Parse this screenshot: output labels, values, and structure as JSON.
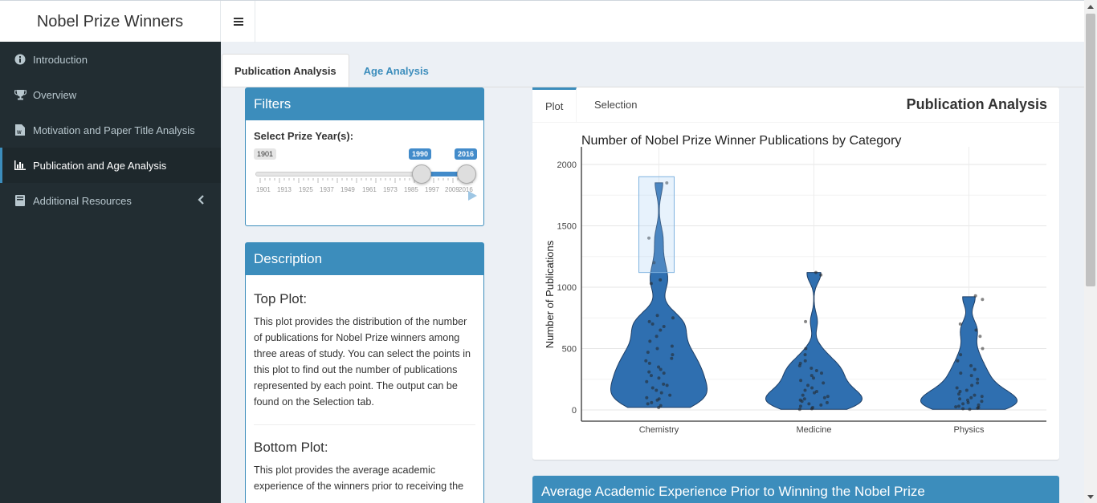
{
  "app": {
    "title": "Nobel Prize Winners"
  },
  "sidebar": {
    "items": [
      {
        "label": "Introduction",
        "icon": "info-circle-icon"
      },
      {
        "label": "Overview",
        "icon": "trophy-icon"
      },
      {
        "label": "Motivation and Paper Title Analysis",
        "icon": "word-file-icon"
      },
      {
        "label": "Publication and Age Analysis",
        "icon": "bar-chart-icon",
        "active": true
      },
      {
        "label": "Additional Resources",
        "icon": "book-icon"
      }
    ]
  },
  "tabs": {
    "publication": "Publication Analysis",
    "age": "Age Analysis"
  },
  "filters": {
    "title": "Filters",
    "label": "Select Prize Year(s):",
    "min": "1901",
    "from": "1990",
    "to": "2016",
    "ticks": [
      "1901",
      "1913",
      "1925",
      "1937",
      "1949",
      "1961",
      "1973",
      "1985",
      "1997",
      "2009",
      "2016"
    ]
  },
  "description": {
    "title": "Description",
    "top_heading": "Top Plot:",
    "top_text": "This plot provides the distribution of the number of publications for Nobel Prize winners among three areas of study. You can select the points in this plot to find out the number of publications represented by each point. The output can be found on the Selection tab.",
    "bottom_heading": "Bottom Plot:",
    "bottom_text": "This plot provides the average academic experience of the winners prior to receiving the"
  },
  "plot_panel": {
    "tab_plot": "Plot",
    "tab_selection": "Selection",
    "title": "Publication Analysis"
  },
  "bottom_box": {
    "title": "Average Academic Experience Prior to Winning the Nobel Prize"
  },
  "chart_data": {
    "type": "violin",
    "title": "Number of Nobel Prize Winner Publications by Category",
    "xlabel": "",
    "ylabel": "Number of Publications",
    "categories": [
      "Chemistry",
      "Medicine",
      "Physics"
    ],
    "ylim": [
      0,
      2000
    ],
    "yticks": [
      0,
      500,
      1000,
      1500,
      2000
    ],
    "color": "#2f6fb0",
    "selection_box": {
      "category": "Chemistry",
      "y_range": [
        1120,
        1900
      ]
    },
    "series": [
      {
        "name": "Chemistry",
        "points": [
          20,
          35,
          50,
          60,
          80,
          90,
          100,
          120,
          140,
          160,
          180,
          200,
          210,
          230,
          260,
          280,
          300,
          310,
          330,
          350,
          380,
          400,
          420,
          450,
          470,
          500,
          520,
          560,
          600,
          650,
          680,
          700,
          720,
          750,
          770,
          1030,
          1060,
          1200,
          1400,
          1850
        ]
      },
      {
        "name": "Medicine",
        "points": [
          5,
          10,
          20,
          30,
          40,
          50,
          60,
          70,
          80,
          90,
          100,
          110,
          120,
          140,
          150,
          160,
          180,
          200,
          220,
          240,
          260,
          280,
          300,
          320,
          340,
          360,
          380,
          400,
          450,
          500,
          720,
          1100,
          1120
        ]
      },
      {
        "name": "Physics",
        "points": [
          5,
          10,
          15,
          20,
          25,
          30,
          40,
          50,
          60,
          70,
          80,
          90,
          100,
          110,
          120,
          130,
          150,
          160,
          180,
          200,
          220,
          250,
          280,
          300,
          330,
          360,
          400,
          450,
          500,
          600,
          650,
          700,
          900,
          930
        ]
      }
    ]
  }
}
